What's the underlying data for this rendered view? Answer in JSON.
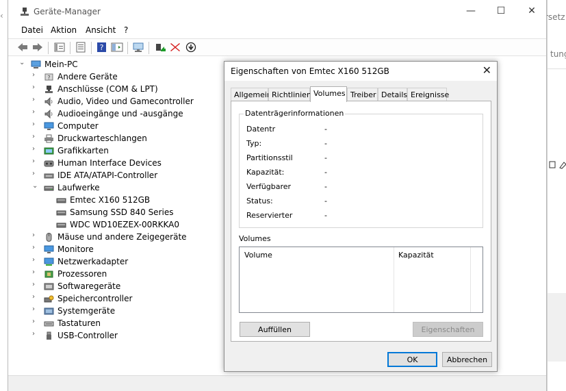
{
  "window": {
    "title": "Geräte-Manager",
    "minimize": "—",
    "maximize": "☐",
    "close": "✕"
  },
  "menu": [
    "Datei",
    "Aktion",
    "Ansicht",
    "?"
  ],
  "tree": {
    "root": "Mein-PC",
    "categories": [
      {
        "label": "Andere Geräte",
        "icon": "other-devices-icon"
      },
      {
        "label": "Anschlüsse (COM & LPT)",
        "icon": "port-icon"
      },
      {
        "label": "Audio, Video und Gamecontroller",
        "icon": "speaker-icon"
      },
      {
        "label": "Audioeingänge und -ausgänge",
        "icon": "speaker-icon"
      },
      {
        "label": "Computer",
        "icon": "monitor-icon"
      },
      {
        "label": "Druckwarteschlangen",
        "icon": "printer-icon"
      },
      {
        "label": "Grafikkarten",
        "icon": "graphics-card-icon"
      },
      {
        "label": "Human Interface Devices",
        "icon": "hid-icon"
      },
      {
        "label": "IDE ATA/ATAPI-Controller",
        "icon": "ide-controller-icon"
      },
      {
        "label": "Laufwerke",
        "icon": "drive-icon",
        "expanded": true,
        "children": [
          "Emtec X160 512GB",
          "Samsung SSD 840 Series",
          "WDC WD10EZEX-00RKKA0"
        ]
      },
      {
        "label": "Mäuse und andere Zeigegeräte",
        "icon": "mouse-icon"
      },
      {
        "label": "Monitore",
        "icon": "monitor-icon"
      },
      {
        "label": "Netzwerkadapter",
        "icon": "network-icon"
      },
      {
        "label": "Prozessoren",
        "icon": "processor-icon"
      },
      {
        "label": "Softwaregeräte",
        "icon": "software-device-icon"
      },
      {
        "label": "Speichercontroller",
        "icon": "storage-controller-icon"
      },
      {
        "label": "Systemgeräte",
        "icon": "system-device-icon"
      },
      {
        "label": "Tastaturen",
        "icon": "keyboard-icon"
      },
      {
        "label": "USB-Controller",
        "icon": "usb-icon"
      }
    ]
  },
  "dialog": {
    "title": "Eigenschaften von Emtec X160 512GB",
    "close": "✕",
    "tabs": [
      "Allgemein",
      "Richtlinien",
      "Volumes",
      "Treiber",
      "Details",
      "Ereignisse"
    ],
    "active_tab": "Volumes",
    "group_title": "Datenträgerinformationen",
    "properties": [
      {
        "label": "Datentr",
        "value": "-"
      },
      {
        "label": "Typ:",
        "value": "-"
      },
      {
        "label": "Partitionsstil",
        "value": "-"
      },
      {
        "label": "Kapazität:",
        "value": "-"
      },
      {
        "label": "Verfügbarer",
        "value": "-"
      },
      {
        "label": "Status:",
        "value": "-"
      },
      {
        "label": "Reservierter",
        "value": "-"
      }
    ],
    "volumes_label": "Volumes",
    "columns": [
      "Volume",
      "Kapazität"
    ],
    "fill_button": "Auffüllen",
    "properties_button": "Eigenschaften",
    "ok_button": "OK",
    "cancel_button": "Abbrechen"
  },
  "background": {
    "fragments": [
      "rsetz",
      "tung"
    ]
  }
}
